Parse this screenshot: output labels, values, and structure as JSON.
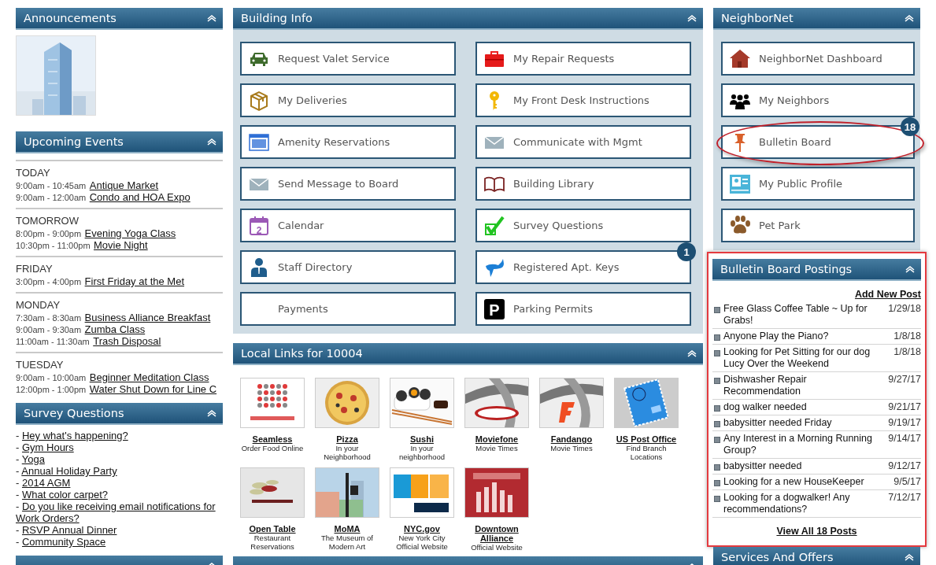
{
  "announcements": {
    "title": "Announcements"
  },
  "upcoming_events": {
    "title": "Upcoming Events",
    "days": [
      {
        "day": "TODAY",
        "events": [
          {
            "time": "9:00am - 10:45am",
            "title": "Antique Market"
          },
          {
            "time": "9:00am - 12:00am",
            "title": "Condo and HOA Expo"
          }
        ]
      },
      {
        "day": "TOMORROW",
        "events": [
          {
            "time": "8:00pm - 9:00pm",
            "title": "Evening Yoga Class"
          },
          {
            "time": "10:30pm - 11:00pm",
            "title": "Movie Night"
          }
        ]
      },
      {
        "day": "FRIDAY",
        "events": [
          {
            "time": "3:00pm - 4:00pm",
            "title": "First Friday at the Met"
          }
        ]
      },
      {
        "day": "MONDAY",
        "events": [
          {
            "time": "7:30am - 8:30am",
            "title": "Business Alliance Breakfast"
          },
          {
            "time": "9:00am - 9:30am",
            "title": "Zumba Class"
          },
          {
            "time": "11:00am - 11:30am",
            "title": "Trash Disposal "
          }
        ]
      },
      {
        "day": "TUESDAY",
        "events": [
          {
            "time": "9:00am - 10:00am",
            "title": "Beginner Meditation Class"
          },
          {
            "time": "12:00pm - 1:00pm",
            "title": "Water Shut Down for Line C"
          }
        ]
      }
    ]
  },
  "survey_questions": {
    "title": "Survey Questions",
    "bullet": "-",
    "items": [
      "Hey what's happening?",
      "Gym Hours",
      "Yoga",
      "Annual Holiday Party",
      "2014 AGM",
      "What color carpet?",
      "Do you like receiving email notifications for Work Orders?",
      "RSVP Annual Dinner",
      "Community Space"
    ]
  },
  "building_info": {
    "title": "Building Info",
    "buttons": [
      {
        "label": "Request Valet Service"
      },
      {
        "label": "My Repair Requests"
      },
      {
        "label": "My Deliveries"
      },
      {
        "label": "My Front Desk Instructions"
      },
      {
        "label": "Amenity Reservations"
      },
      {
        "label": "Communicate with Mgmt"
      },
      {
        "label": "Send Message to Board"
      },
      {
        "label": "Building Library"
      },
      {
        "label": "Calendar",
        "icon_text": "2"
      },
      {
        "label": "Survey Questions"
      },
      {
        "label": "Staff Directory"
      },
      {
        "label": "Registered Apt. Keys",
        "badge": "1"
      },
      {
        "label": "Payments"
      },
      {
        "label": "Parking Permits",
        "icon_text": "P"
      }
    ]
  },
  "local_links": {
    "title": "Local Links for 10004",
    "links": [
      {
        "name": "Seamless",
        "subtitle": "Order Food Online",
        "kind": "picture"
      },
      {
        "name": "Pizza",
        "subtitle": "In your Neighborhood",
        "kind": "picture"
      },
      {
        "name": "Sushi",
        "subtitle": "In your neighborhood",
        "kind": "picture"
      },
      {
        "name": "Moviefone",
        "subtitle": "Movie Times",
        "kind": "picture"
      },
      {
        "name": "Fandango",
        "subtitle": "Movie Times",
        "kind": "picture"
      },
      {
        "name": "US Post Office",
        "subtitle": "Find Branch Locations",
        "kind": "picture"
      },
      {
        "name": "Open Table",
        "subtitle": "Restaurant Reservations",
        "kind": "picture"
      },
      {
        "name": "MoMA",
        "subtitle": "The Museum of Modern Art",
        "kind": "picture"
      },
      {
        "name": "NYC.gov",
        "subtitle": "New York City Official Website",
        "kind": "picture"
      },
      {
        "name": "Downtown Alliance",
        "subtitle": "Official Website",
        "kind": "picture"
      }
    ]
  },
  "neighbornet": {
    "title": "NeighborNet",
    "buttons": [
      {
        "label": "NeighborNet Dashboard",
        "highlighted": false
      },
      {
        "label": "My Neighbors",
        "highlighted": false
      },
      {
        "label": "Bulletin Board",
        "badge": "18",
        "highlighted": true
      },
      {
        "label": "My Public Profile",
        "highlighted": false
      },
      {
        "label": "Pet Park",
        "highlighted": false
      }
    ]
  },
  "bulletin_board_postings": {
    "title": "Bulletin Board Postings",
    "highlighted": true,
    "add_link": "Add New Post",
    "view_all": "View All 18 Posts",
    "posts": [
      {
        "title": "Free Glass Coffee Table ~ Up for Grabs!",
        "date": "1/29/18"
      },
      {
        "title": "Anyone Play the Piano?",
        "date": "1/8/18"
      },
      {
        "title": "Looking for Pet Sitting for our dog Lucy Over the Weekend",
        "date": "1/8/18"
      },
      {
        "title": "Dishwasher Repair Recommendation",
        "date": "9/27/17"
      },
      {
        "title": "dog walker needed",
        "date": "9/21/17"
      },
      {
        "title": "babysitter needed Friday",
        "date": "9/19/17"
      },
      {
        "title": "Any Interest in a Morning Running Group?",
        "date": "9/14/17"
      },
      {
        "title": "babysitter needed",
        "date": "9/12/17"
      },
      {
        "title": "Looking for a new HouseKeeper",
        "date": "9/5/17"
      },
      {
        "title": "Looking for a dogwalker! Any recommendations?",
        "date": "7/12/17"
      }
    ]
  },
  "services_and_offers": {
    "title": "Services And Offers"
  }
}
